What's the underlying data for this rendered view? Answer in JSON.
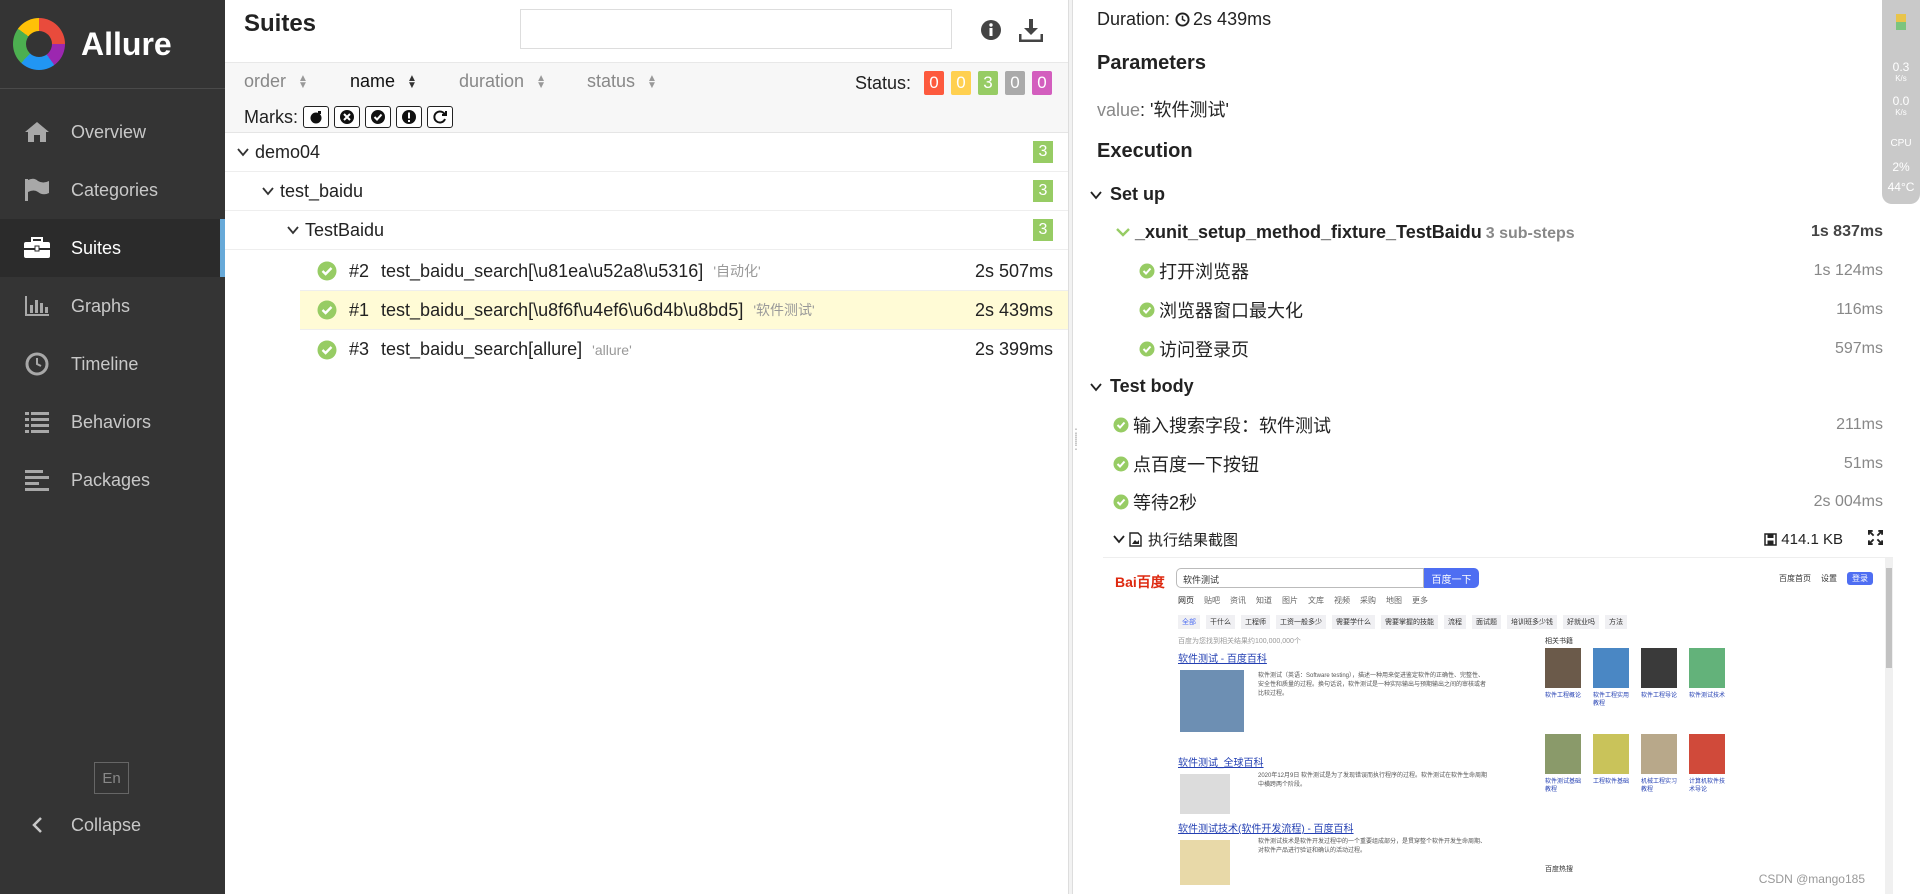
{
  "app": {
    "name": "Allure"
  },
  "sidebar": {
    "items": [
      {
        "label": "Overview",
        "icon": "home-icon",
        "active": false
      },
      {
        "label": "Categories",
        "icon": "flag-icon",
        "active": false
      },
      {
        "label": "Suites",
        "icon": "briefcase-icon",
        "active": true
      },
      {
        "label": "Graphs",
        "icon": "bar-chart-icon",
        "active": false
      },
      {
        "label": "Timeline",
        "icon": "clock-icon",
        "active": false
      },
      {
        "label": "Behaviors",
        "icon": "list-icon",
        "active": false
      },
      {
        "label": "Packages",
        "icon": "align-left-icon",
        "active": false
      }
    ],
    "lang": "En",
    "collapse": "Collapse"
  },
  "suites": {
    "title": "Suites",
    "search_value": "",
    "sort": [
      "order",
      "name",
      "duration",
      "status"
    ],
    "status_label": "Status:",
    "status_counts": [
      {
        "value": "0",
        "color": "#fd5a3e"
      },
      {
        "value": "0",
        "color": "#ffd050"
      },
      {
        "value": "3",
        "color": "#97cc64"
      },
      {
        "value": "0",
        "color": "#aaaaaa"
      },
      {
        "value": "0",
        "color": "#d35ebe"
      }
    ],
    "marks_label": "Marks:",
    "tree": {
      "level1": {
        "name": "demo04",
        "count": "3"
      },
      "level2": {
        "name": "test_baidu",
        "count": "3"
      },
      "level3": {
        "name": "TestBaidu",
        "count": "3"
      }
    },
    "cases": [
      {
        "num": "#2",
        "name": "test_baidu_search[\\u81ea\\u52a8\\u5316]",
        "param": "'自动化'",
        "duration": "2s 507ms"
      },
      {
        "num": "#1",
        "name": "test_baidu_search[\\u8f6f\\u4ef6\\u6d4b\\u8bd5]",
        "param": "'软件测试'",
        "duration": "2s 439ms"
      },
      {
        "num": "#3",
        "name": "test_baidu_search[allure]",
        "param": "'allure'",
        "duration": "2s 399ms"
      }
    ]
  },
  "detail": {
    "duration_label": "Duration:",
    "duration_value": "2s 439ms",
    "parameters_title": "Parameters",
    "param_key": "value",
    "param_value": ": '软件测试'",
    "execution_title": "Execution",
    "setup_title": "Set up",
    "fixture": {
      "name": "_xunit_setup_method_fixture_TestBaidu",
      "sub": "3 sub-steps",
      "duration": "1s 837ms"
    },
    "setup_steps": [
      {
        "name": "打开浏览器",
        "duration": "1s 124ms"
      },
      {
        "name": "浏览器窗口最大化",
        "duration": "116ms"
      },
      {
        "name": "访问登录页",
        "duration": "597ms"
      }
    ],
    "body_title": "Test body",
    "body_steps": [
      {
        "name": "输入搜索字段：软件测试",
        "duration": "211ms"
      },
      {
        "name": "点百度一下按钮",
        "duration": "51ms"
      },
      {
        "name": "等待2秒",
        "duration": "2s 004ms"
      }
    ],
    "attachment": {
      "name": "执行结果截图",
      "size": "414.1 KB"
    }
  },
  "screenshot": {
    "logo": "Bai百度",
    "query": "软件测试",
    "button": "百度一下",
    "top_links": [
      "百度首页",
      "设置"
    ],
    "login": "登录",
    "tabs": [
      "网页",
      "贴吧",
      "资讯",
      "知道",
      "图片",
      "文库",
      "视频",
      "采购",
      "地图",
      "更多"
    ],
    "chips": [
      "全部",
      "干什么",
      "工程师",
      "工资一般多少",
      "需要学什么",
      "需要掌握的技能",
      "流程",
      "面试题",
      "培训班多少钱",
      "好就业吗",
      "方法"
    ],
    "result_count": "百度为您找到相关结果约100,000,000个",
    "results": [
      "软件测试 - 百度百科",
      "软件测试_全球百科",
      "软件测试技术(软件开发流程) - 百度百科"
    ],
    "snippet1": "软件测试（英语：Software testing），描述一种用来促进鉴定软件的正确性、完整性、安全性和质量的过程。换句话说，软件测试是一种实际输出与预期输出之间的审核或者比较过程。",
    "snippet2": "2020年12月9日 软件测试是为了发现错误而执行程序的过程。软件测试在软件生命周期中横跨两个阶段。",
    "snippet3": "软件测试技术是软件开发过程中的一个重要组成部分，是贯穿整个软件开发生命周期、对软件产品进行验证和确认的活动过程。",
    "sidebar_title": "相关书籍",
    "books": [
      "软件工程概论",
      "软件工程实用教程",
      "软件工程导论",
      "软件测试技术",
      "软件测试基础教程",
      "工程软件基础",
      "机械工程实习教程",
      "计算机软件技术导论"
    ],
    "hot_title": "百度热搜",
    "watermark": "CSDN @mango185"
  },
  "widget": {
    "up": "0.3",
    "down": "0.0",
    "unit": "K/s",
    "cpu_label": "CPU",
    "cpu": "2%",
    "temp": "44°C"
  }
}
